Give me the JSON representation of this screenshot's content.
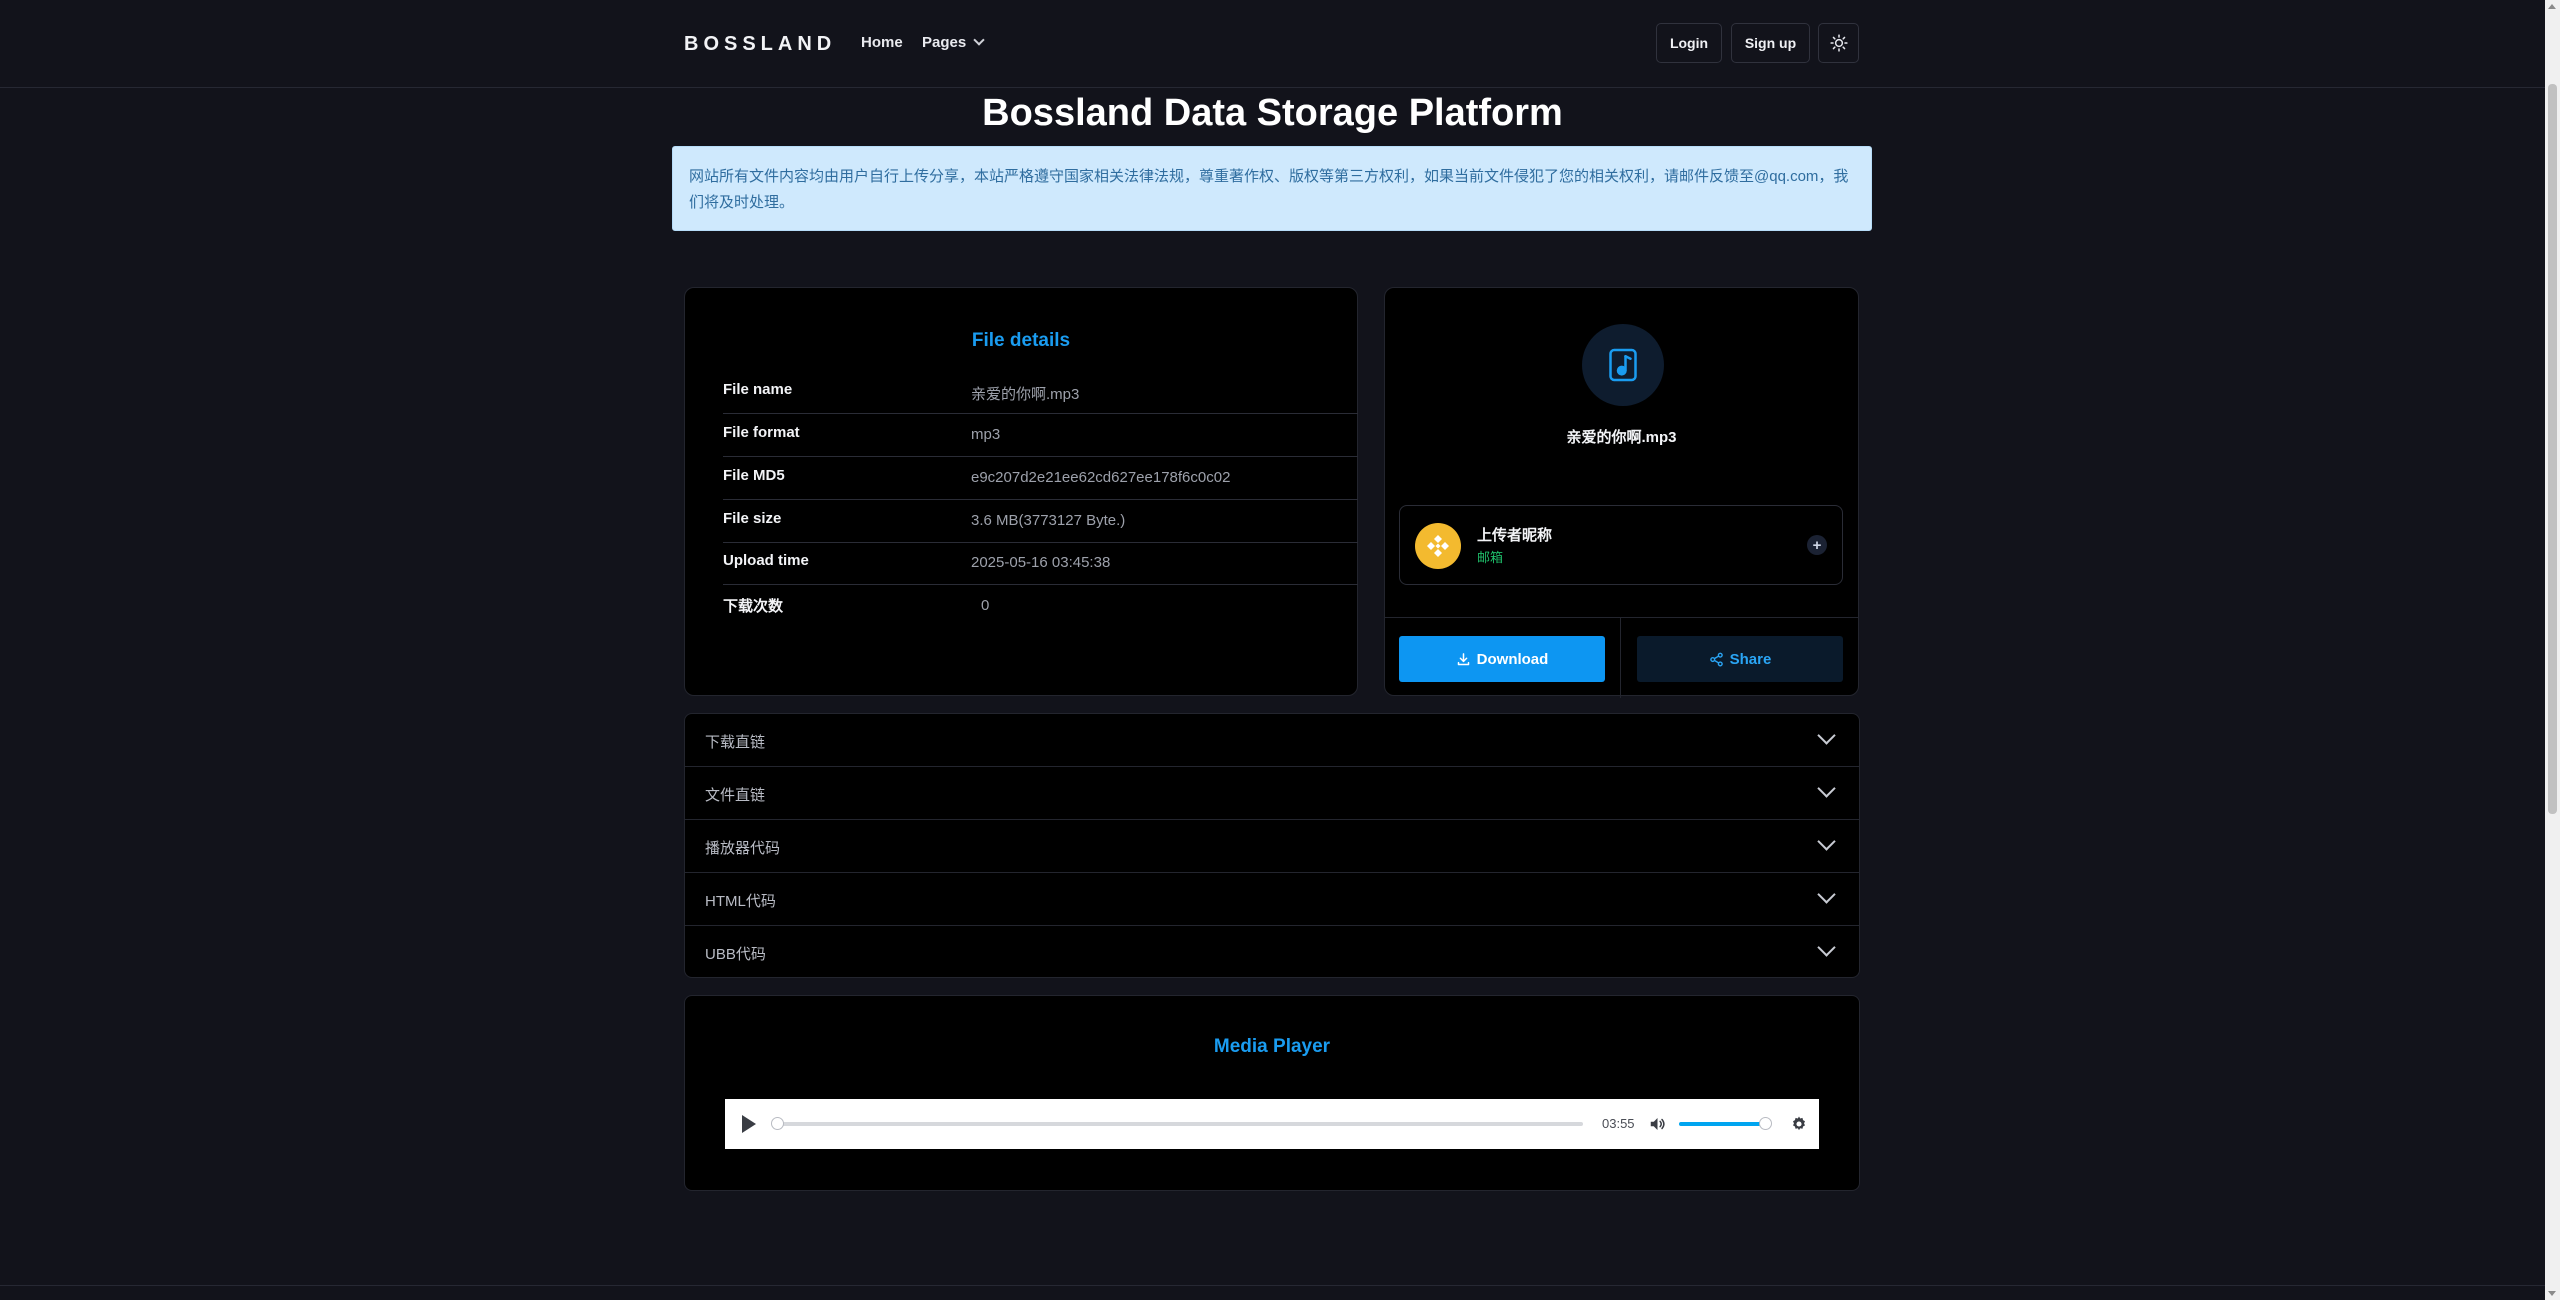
{
  "nav": {
    "brand": "BOSSLAND",
    "links": [
      "Home",
      "Pages"
    ],
    "login": "Login",
    "signup": "Sign up",
    "theme_icon": "sun-icon"
  },
  "page": {
    "title": "Bossland Data Storage Platform",
    "notice": "网站所有文件内容均由用户自行上传分享，本站严格遵守国家相关法律法规，尊重著作权、版权等第三方权利，如果当前文件侵犯了您的相关权利，请邮件反馈至@qq.com，我们将及时处理。"
  },
  "details": {
    "title": "File details",
    "rows": [
      {
        "label": "File name",
        "value": "亲爱的你啊.mp3"
      },
      {
        "label": "File format",
        "value": "mp3"
      },
      {
        "label": "File MD5",
        "value": "e9c207d2e21ee62cd627ee178f6c0c02"
      },
      {
        "label": "File size",
        "value": "3.6 MB(3773127 Byte.)"
      },
      {
        "label": "Upload time",
        "value": "2025-05-16 03:45:38"
      },
      {
        "label": "下载次数",
        "value": "0"
      }
    ]
  },
  "file_card": {
    "icon": "music-file-icon",
    "file_name": "亲爱的你啊.mp3",
    "uploader_name": "上传者昵称",
    "uploader_sub": "邮箱",
    "follow_label": "+",
    "download_label": "Download",
    "share_label": "Share"
  },
  "accordion": {
    "items": [
      "下载直链",
      "文件直链",
      "播放器代码",
      "HTML代码",
      "UBB代码"
    ]
  },
  "player": {
    "title": "Media Player",
    "time": "03:55",
    "progress": 0,
    "volume": 1.0
  },
  "colors": {
    "accent": "#0d96f2",
    "background": "#12131b",
    "card": "#000000",
    "notice_bg": "#cfe9fd",
    "avatar": "#f3ba2f"
  }
}
